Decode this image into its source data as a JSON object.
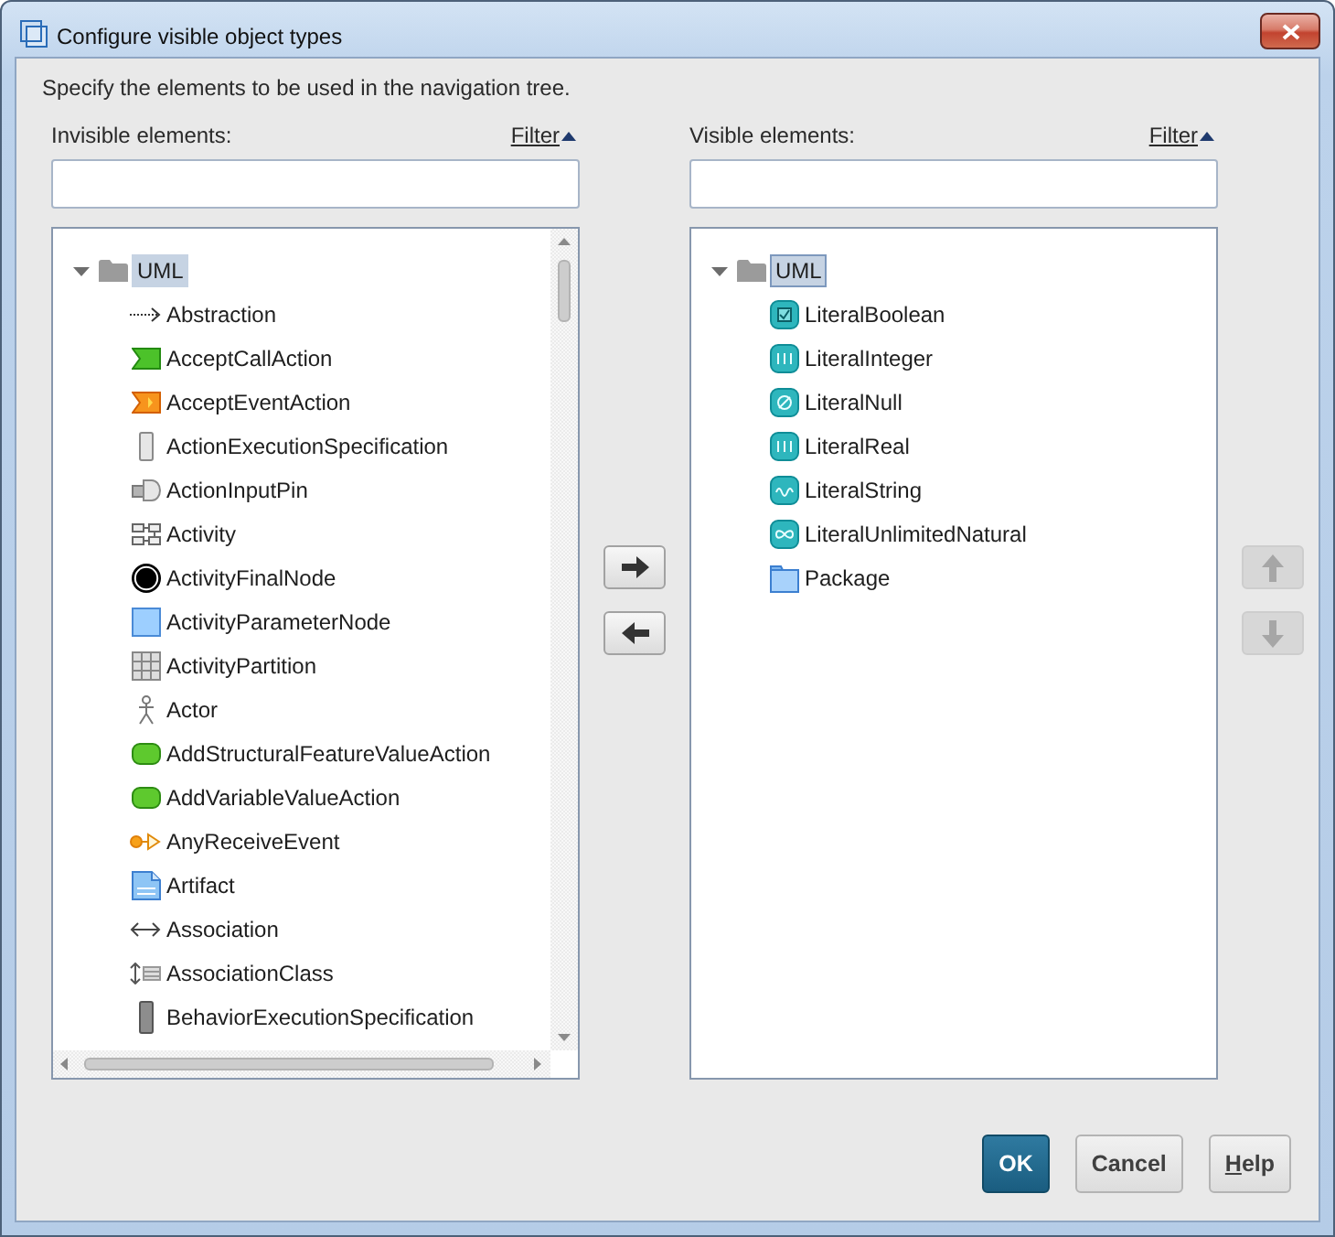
{
  "window": {
    "title": "Configure visible object types"
  },
  "description": "Specify the elements to be used in the navigation tree.",
  "panels": [
    {
      "label": "Invisible elements:",
      "filter": {
        "label": "Filter",
        "expanded": true
      },
      "tree": {
        "focused": false,
        "scrollbars": true,
        "nodes": [
          {
            "label": "UML",
            "kind": "folder",
            "expanded": true,
            "selected": true,
            "children": [
              {
                "label": "Abstraction",
                "kind": "abstraction",
                "selected": false
              },
              {
                "label": "AcceptCallAction",
                "kind": "acceptcall",
                "selected": false
              },
              {
                "label": "AcceptEventAction",
                "kind": "acceptevent",
                "selected": false
              },
              {
                "label": "ActionExecutionSpecification",
                "kind": "execspec",
                "selected": false
              },
              {
                "label": "ActionInputPin",
                "kind": "inputpin",
                "selected": false
              },
              {
                "label": "Activity",
                "kind": "activity",
                "selected": false
              },
              {
                "label": "ActivityFinalNode",
                "kind": "finalnode",
                "selected": false
              },
              {
                "label": "ActivityParameterNode",
                "kind": "paramnode",
                "selected": false
              },
              {
                "label": "ActivityPartition",
                "kind": "partition",
                "selected": false
              },
              {
                "label": "Actor",
                "kind": "actor",
                "selected": false
              },
              {
                "label": "AddStructuralFeatureValueAction",
                "kind": "action",
                "selected": false
              },
              {
                "label": "AddVariableValueAction",
                "kind": "action",
                "selected": false
              },
              {
                "label": "AnyReceiveEvent",
                "kind": "anyreceive",
                "selected": false
              },
              {
                "label": "Artifact",
                "kind": "artifact",
                "selected": false
              },
              {
                "label": "Association",
                "kind": "association",
                "selected": false
              },
              {
                "label": "AssociationClass",
                "kind": "assocclass",
                "selected": false
              },
              {
                "label": "BehaviorExecutionSpecification",
                "kind": "behaviorspec",
                "selected": false
              }
            ]
          }
        ]
      }
    },
    {
      "label": "Visible elements:",
      "filter": {
        "label": "Filter",
        "expanded": true
      },
      "tree": {
        "focused": true,
        "scrollbars": false,
        "nodes": [
          {
            "label": "UML",
            "kind": "folder",
            "expanded": true,
            "selected": true,
            "children": [
              {
                "label": "LiteralBoolean",
                "kind": "literalboolean",
                "selected": false
              },
              {
                "label": "LiteralInteger",
                "kind": "literalnumber",
                "selected": false
              },
              {
                "label": "LiteralNull",
                "kind": "literalnull",
                "selected": false
              },
              {
                "label": "LiteralReal",
                "kind": "literalnumber",
                "selected": false
              },
              {
                "label": "LiteralString",
                "kind": "literalstring",
                "selected": false
              },
              {
                "label": "LiteralUnlimitedNatural",
                "kind": "literalunlimited",
                "selected": false
              },
              {
                "label": "Package",
                "kind": "package",
                "selected": false
              }
            ]
          }
        ]
      }
    }
  ],
  "move_buttons": [
    {
      "kind": "right",
      "disabled": false
    },
    {
      "kind": "left",
      "disabled": false
    }
  ],
  "order_buttons": [
    {
      "kind": "up",
      "disabled": true
    },
    {
      "kind": "down",
      "disabled": true
    }
  ],
  "buttons": [
    {
      "label": "OK",
      "default": true,
      "mnemonic": false
    },
    {
      "label": "Cancel",
      "default": false,
      "mnemonic": false
    },
    {
      "label": "Help",
      "default": false,
      "mnemonic": true
    }
  ]
}
